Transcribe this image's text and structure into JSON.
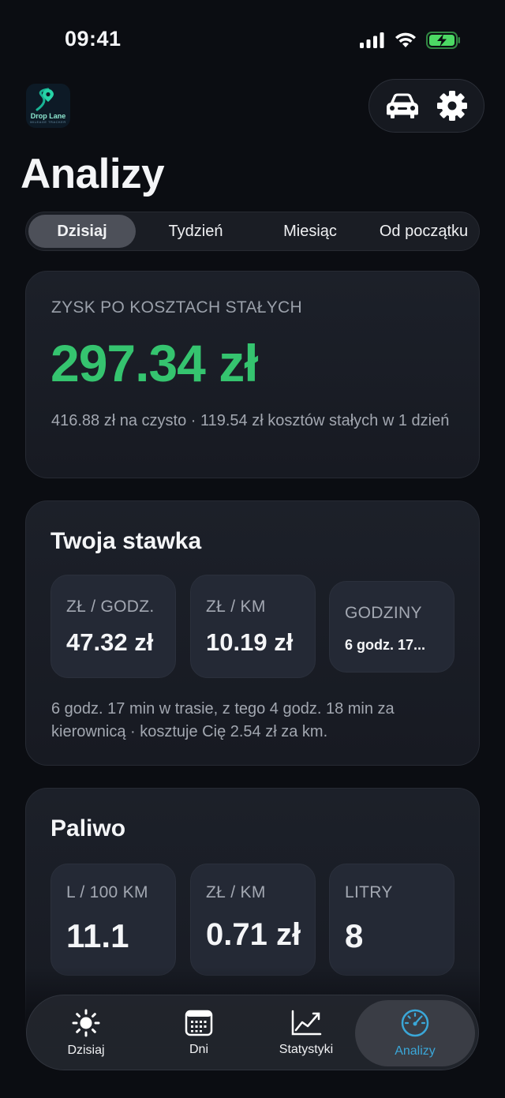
{
  "status_bar": {
    "time": "09:41"
  },
  "logo": {
    "text": "Drop Lane",
    "subtext": "MILEAGE TRACKER"
  },
  "page": {
    "title": "Analizy"
  },
  "segments": [
    {
      "label": "Dzisiaj",
      "active": true
    },
    {
      "label": "Tydzień",
      "active": false
    },
    {
      "label": "Miesiąc",
      "active": false
    },
    {
      "label": "Od początku",
      "active": false
    }
  ],
  "profit_card": {
    "eyebrow": "ZYSK PO KOSZTACH STAŁYCH",
    "value": "297.34 zł",
    "note": "416.88 zł na czysto · 119.54 zł kosztów stałych w 1 dzień"
  },
  "rate_card": {
    "title": "Twoja stawka",
    "tiles": [
      {
        "label": "ZŁ / GODZ.",
        "value": "47.32 zł"
      },
      {
        "label": "ZŁ / KM",
        "value": "10.19 zł"
      },
      {
        "label": "GODZINY",
        "value": "6 godz. 17..."
      }
    ],
    "note": "6 godz. 17 min w trasie, z tego 4 godz. 18 min za kierownicą · kosztuje Cię 2.54 zł za km."
  },
  "fuel_card": {
    "title": "Paliwo",
    "tiles": [
      {
        "label": "L / 100 KM",
        "value": "11.1"
      },
      {
        "label": "ZŁ / KM",
        "value": "0.71 zł"
      },
      {
        "label": "LITRY",
        "value": "8"
      }
    ]
  },
  "tabbar": {
    "tabs": [
      {
        "label": "Dzisiaj",
        "icon": "sun-icon"
      },
      {
        "label": "Dni",
        "icon": "calendar-icon"
      },
      {
        "label": "Statystyki",
        "icon": "chart-line-icon"
      },
      {
        "label": "Analizy",
        "icon": "speedometer-icon",
        "active": true
      }
    ]
  },
  "colors": {
    "profit": "#35c46f",
    "accent": "#3aa7d8",
    "battery": "#4cd964"
  }
}
